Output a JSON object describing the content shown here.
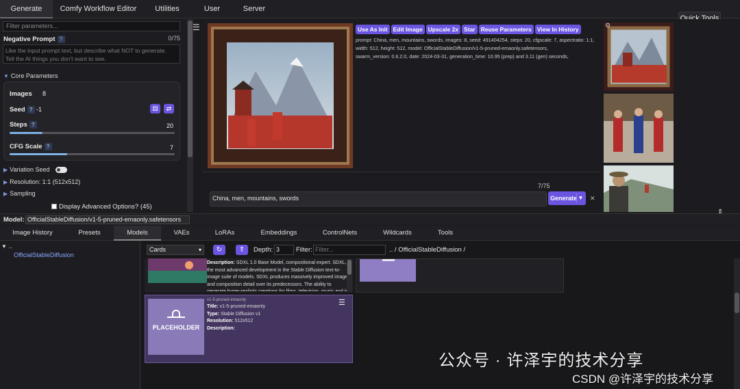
{
  "top_tabs": [
    "Generate",
    "Comfy Workflow Editor",
    "Utilities",
    "User",
    "Server"
  ],
  "quick_tools": "Quick Tools",
  "left": {
    "filter_placeholder": "Filter parameters...",
    "neg_label": "Negative Prompt",
    "neg_count": "0/75",
    "neg_placeholder": "Like the input prompt text, but describe what NOT to generate.\nTell the AI things you don't want to see.",
    "core_label": "Core Parameters",
    "images_label": "Images",
    "images_value": "8",
    "seed_label": "Seed",
    "seed_value": "-1",
    "steps_label": "Steps",
    "steps_value": "20",
    "steps_fill": 0.2,
    "cfg_label": "CFG Scale",
    "cfg_value": "7",
    "cfg_fill": 0.35,
    "variation_label": "Variation Seed",
    "resolution_label": "Resolution: 1:1 (512x512)",
    "sampling_label": "Sampling",
    "adv_label": "Display Advanced Options? (45)"
  },
  "center": {
    "buttons": [
      "Use As Init",
      "Edit Image",
      "Upscale 2x",
      "Star",
      "Reuse Parameters",
      "View In History"
    ],
    "meta_line1": "prompt: China, men, mountains, swords, images: 8, seed: 491404254, steps: 20, cfgscale: 7, aspectratio: 1:1,",
    "meta_line2": "width: 512, height: 512, model: OfficialStableDiffusion/v1-5-pruned-emaonly.safetensors,",
    "meta_line3": "swarm_version: 0.6.2.0, date: 2024-03-31, generation_time: 10.95 (prep) and 3.11 (gen) seconds,",
    "token_count": "7/75",
    "prompt_text": "China, men, mountains, swords",
    "generate_label": "Generate"
  },
  "model_bar": {
    "label": "Model:",
    "value": "OfficialStableDiffusion/v1-5-pruned-emaonly.safetensors"
  },
  "bottom_tabs": [
    "Image History",
    "Presets",
    "Models",
    "VAEs",
    "LoRAs",
    "Embeddings",
    "ControlNets",
    "Wildcards",
    "Tools"
  ],
  "browser": {
    "tree_root": "..",
    "tree_node": "OfficialStableDiffusion",
    "view_mode": "Cards",
    "depth_label": "Depth:",
    "depth_value": "3",
    "filter_label": "Filter:",
    "filter_placeholder": "Filter...",
    "breadcrumb": ".. / OfficialStableDiffusion /",
    "card1_desc_label": "Description:",
    "card1_desc": "SDXL 1.0 Base Model, compositional expert. SDXL, the most advanced development in the Stable Diffusion text-to-image suite of models. SDXL produces massively improved image and composition detail over its predecessors. The ability to generate hyper-realistic creations for films, television, music and in",
    "card3_name": "v1-5-pruned-emaonly",
    "card3_title_label": "Title:",
    "card3_title": "v1-5-pruned-emaonly",
    "card3_type_label": "Type:",
    "card3_type": "Stable Diffusion v1",
    "card3_res_label": "Resolution:",
    "card3_res": "512x512",
    "card3_desc_label": "Description:",
    "placeholder_text": "PLACEHOLDER"
  },
  "watermark": {
    "line1": "公众号 · 许泽宇的技术分享",
    "line2": "CSDN @许泽宇的技术分享"
  },
  "colors": {
    "accent": "#6a55e0",
    "link": "#8ca6ff",
    "slider": "#7fb1e6"
  }
}
